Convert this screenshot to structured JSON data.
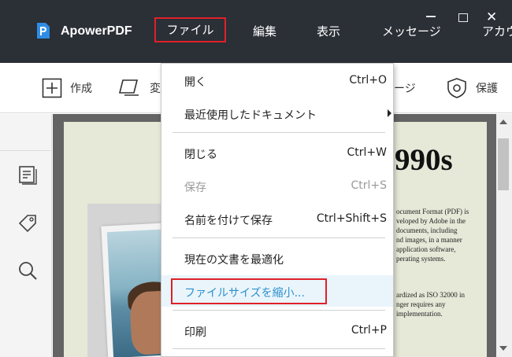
{
  "titlebar": {
    "app_name": "ApowerPDF",
    "menus": [
      "ファイル",
      "編集",
      "表示",
      "メッセージ",
      "アカウ"
    ],
    "window_controls": [
      "minimize-icon",
      "maximize-icon",
      "close-icon"
    ],
    "close_glyph": "✕"
  },
  "toolbar": {
    "create_label": "作成",
    "convert_label": "変",
    "page_label": "ージ",
    "protect_label": "保護"
  },
  "sidebar": {
    "icons": [
      "pages-icon",
      "tag-icon",
      "search-icon"
    ]
  },
  "document": {
    "heading": "990s",
    "paragraph1": [
      "ocument Format (PDF) is",
      "veloped by Adobe in the",
      " documents, including",
      "nd images, in a manner",
      " application software,",
      "perating systems."
    ],
    "paragraph2": [
      "ardized as ISO 32000 in",
      "nger requires any",
      " implementation."
    ]
  },
  "file_menu": {
    "items": [
      {
        "label": "開く",
        "shortcut": "Ctrl+O"
      },
      {
        "label": "最近使用したドキュメント",
        "shortcut": ""
      },
      {
        "label": "閉じる",
        "shortcut": "Ctrl+W"
      },
      {
        "label": "保存",
        "shortcut": "Ctrl+S"
      },
      {
        "label": "名前を付けて保存",
        "shortcut": "Ctrl+Shift+S"
      },
      {
        "label": "現在の文書を最適化",
        "shortcut": ""
      },
      {
        "label": "ファイルサイズを縮小...",
        "shortcut": ""
      },
      {
        "label": "印刷",
        "shortcut": "Ctrl+P"
      }
    ]
  },
  "colors": {
    "titlebar_bg": "#2b2f36",
    "highlight_border": "#e0202a",
    "link_blue": "#2a8fcf",
    "page_bg": "#e6e8d8"
  }
}
